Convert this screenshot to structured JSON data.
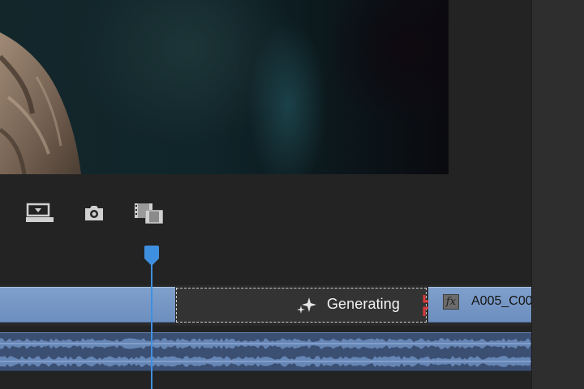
{
  "toolbar": {
    "icons": [
      "export-frame-icon",
      "camera-icon",
      "film-clips-icon"
    ]
  },
  "timeline": {
    "generating_label": "Generating",
    "clip_right": {
      "fx_label": "fx",
      "name": "A005_C00"
    }
  },
  "colors": {
    "accent": "#3f8fe0",
    "clip": "#7496c6",
    "edit_point": "#d93a3a"
  }
}
